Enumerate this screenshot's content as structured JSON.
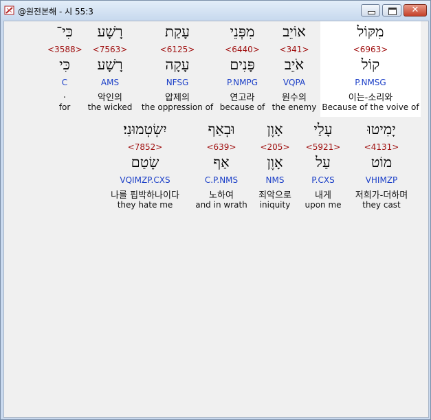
{
  "window": {
    "title": "@원전본해 - 시 55:3"
  },
  "row1": [
    {
      "heb": "מִקּוֹל",
      "strong": "<6963>",
      "lemma": "קוֹל",
      "code": "P.NMSG",
      "kor": "이는-소리와",
      "eng": "Because of the voive of"
    },
    {
      "heb": "אוֹיֵב",
      "strong": "<341>",
      "lemma": "אֹיֵב",
      "code": "VQPA",
      "kor": "원수의",
      "eng": "the enemy"
    },
    {
      "heb": "מִפְּנֵי",
      "strong": "<6440>",
      "lemma": "פָּנִים",
      "code": "P.NMPG",
      "kor": "연고라",
      "eng": "because of"
    },
    {
      "heb": "עָקַת",
      "strong": "<6125>",
      "lemma": "עָקָה",
      "code": "NFSG",
      "kor": "압제의",
      "eng": "the oppression of"
    },
    {
      "heb": "רָשָׁע",
      "strong": "<7563>",
      "lemma": "רָשָׁע",
      "code": "AMS",
      "kor": "악인의",
      "eng": "the wicked"
    },
    {
      "heb": "כִּי־",
      "strong": "<3588>",
      "lemma": "כִּי",
      "code": "C",
      "kor": ".",
      "eng": "for"
    }
  ],
  "row2": [
    {
      "heb": "יָמִיטוּ",
      "strong": "<4131>",
      "lemma": "מוֹט",
      "code": "VHIMZP",
      "kor": "저희가-더하며",
      "eng": "they cast"
    },
    {
      "heb": "עָלַי",
      "strong": "<5921>",
      "lemma": "עַל",
      "code": "P.CXS",
      "kor": "내게",
      "eng": "upon me"
    },
    {
      "heb": "אָוֶן",
      "strong": "<205>",
      "lemma": "אָוֶן",
      "code": "NMS",
      "kor": "죄악으로",
      "eng": "iniquity"
    },
    {
      "heb": "וּבְאַף",
      "strong": "<639>",
      "lemma": "אַף",
      "code": "C.P.NMS",
      "kor": "노하여",
      "eng": "and in wrath"
    },
    {
      "heb": "יִשְׂטְמוּנִי׃",
      "strong": "<7852>",
      "lemma": "שָׂטַם",
      "code": "VQIMZP.CXS",
      "kor": "나를 핍박하나이다",
      "eng": "they hate me"
    }
  ]
}
